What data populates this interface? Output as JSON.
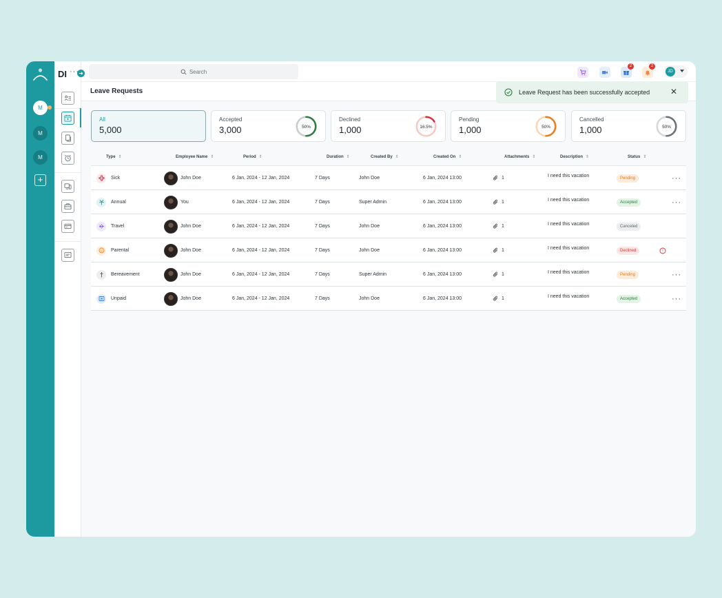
{
  "app": {
    "brand": "DI",
    "brand_dots": "···",
    "expand_glyph": "➜"
  },
  "rail": {
    "workspaces": [
      "M",
      "M",
      "M"
    ],
    "add_glyph": "+"
  },
  "search": {
    "placeholder": "Search"
  },
  "topbar": {
    "icons": [
      {
        "name": "cart-icon",
        "color": "#8e5ce6",
        "bg": "#efe7fb",
        "badge": ""
      },
      {
        "name": "video-icon",
        "color": "#4f86d6",
        "bg": "#e5eefb",
        "badge": ""
      },
      {
        "name": "gift-icon",
        "color": "#3b7bd4",
        "bg": "#dde9f8",
        "badge": "2"
      },
      {
        "name": "bell-icon",
        "color": "#f28a3a",
        "bg": "#fdebdc",
        "badge": "2"
      }
    ],
    "user_initials": "JD"
  },
  "page": {
    "title": "Leave Requests"
  },
  "toast": {
    "message": "Leave Request has been successfully accepted",
    "close": "✕"
  },
  "summary_cards": [
    {
      "label": "All",
      "value": "5,000"
    },
    {
      "label": "Accepted",
      "value": "3,000",
      "percent_text": "50%",
      "percent": 50,
      "color": "#2e7d3e",
      "track": "#c9ccce"
    },
    {
      "label": "Declined",
      "value": "1,000",
      "percent_text": "16.5%",
      "percent": 16.5,
      "color": "#d92b3a",
      "track": "#f7c9c4"
    },
    {
      "label": "Pending",
      "value": "1,000",
      "percent_text": "50%",
      "percent": 50,
      "color": "#ee7d1a",
      "track": "#f9d6b6"
    },
    {
      "label": "Cancelled",
      "value": "1,000",
      "percent_text": "50%",
      "percent": 50,
      "color": "#6b7276",
      "track": "#d4d8da"
    }
  ],
  "table": {
    "headers": [
      "Type",
      "Employee Name",
      "Period",
      "Duration",
      "Created By",
      "Created On",
      "Attachments",
      "Description",
      "Status"
    ],
    "sort_glyph": "⇕",
    "rows": [
      {
        "type": "Sick",
        "type_icon": "medical-cross-icon",
        "icon_color": "#e0394d",
        "icon_bg": "#fde8ea",
        "employee": "John Doe",
        "period": "6 Jan, 2024 - 12 Jan, 2024",
        "duration": "7 Days",
        "created_by": "John Doe",
        "created_on": "6 Jan, 2024 13:00",
        "attachments": "1",
        "description": "I need this vacation",
        "status": "Pending",
        "status_color": "#e07a18",
        "status_bg": "#fdebd9",
        "action": "···",
        "warning": ""
      },
      {
        "type": "Annual",
        "type_icon": "palm-tree-icon",
        "icon_color": "#1c9aa0",
        "icon_bg": "#e1f3f3",
        "employee": "You",
        "period": "6 Jan, 2024 - 12 Jan, 2024",
        "duration": "7 Days",
        "created_by": "Super Admin",
        "created_on": "6 Jan, 2024 13:00",
        "attachments": "1",
        "description": "I need this vacation",
        "status": "Accepted",
        "status_color": "#2e7d3e",
        "status_bg": "#e3f3e5",
        "action": "···",
        "warning": ""
      },
      {
        "type": "Travel",
        "type_icon": "plane-icon",
        "icon_color": "#8666d8",
        "icon_bg": "#eee9fb",
        "employee": "John Doe",
        "period": "6 Jan, 2024 - 12 Jan, 2024",
        "duration": "7 Days",
        "created_by": "John Doe",
        "created_on": "6 Jan, 2024 13:00",
        "attachments": "1",
        "description": "I need this vacation",
        "status": "Canceled",
        "status_color": "#5d6468",
        "status_bg": "#eceeef",
        "action": "",
        "warning": ""
      },
      {
        "type": "Parental",
        "type_icon": "baby-icon",
        "icon_color": "#ef8a2c",
        "icon_bg": "#fdeedd",
        "employee": "John Doe",
        "period": "6 Jan, 2024 - 12 Jan, 2024",
        "duration": "7 Days",
        "created_by": "John Doe",
        "created_on": "6 Jan, 2024 13:00",
        "attachments": "1",
        "description": "I need this vacation",
        "status": "Declined",
        "status_color": "#d6363a",
        "status_bg": "#fde6e6",
        "action": "",
        "warning": "!"
      },
      {
        "type": "Bereavement",
        "type_icon": "cross-icon",
        "icon_color": "#5f666a",
        "icon_bg": "#eceeef",
        "employee": "John Doe",
        "period": "6 Jan, 2024 - 12 Jan, 2024",
        "duration": "7 Days",
        "created_by": "Super Admin",
        "created_on": "6 Jan, 2024 13:00",
        "attachments": "1",
        "description": "I need this vacation",
        "status": "Pending",
        "status_color": "#e07a18",
        "status_bg": "#fdebd9",
        "action": "···",
        "warning": ""
      },
      {
        "type": "Unpaid",
        "type_icon": "money-icon",
        "icon_color": "#3b7bd4",
        "icon_bg": "#e4edfa",
        "employee": "John Doe",
        "period": "6 Jan, 2024 - 12 Jan, 2024",
        "duration": "7 Days",
        "created_by": "John Doe",
        "created_on": "6 Jan, 2024 13:00",
        "attachments": "1",
        "description": "I need this vacation",
        "status": "Accepted",
        "status_color": "#2e7d3e",
        "status_bg": "#e3f3e5",
        "action": "···",
        "warning": ""
      }
    ]
  },
  "colors": {
    "accent": "#1c9aa0",
    "background": "#d4ecec"
  }
}
